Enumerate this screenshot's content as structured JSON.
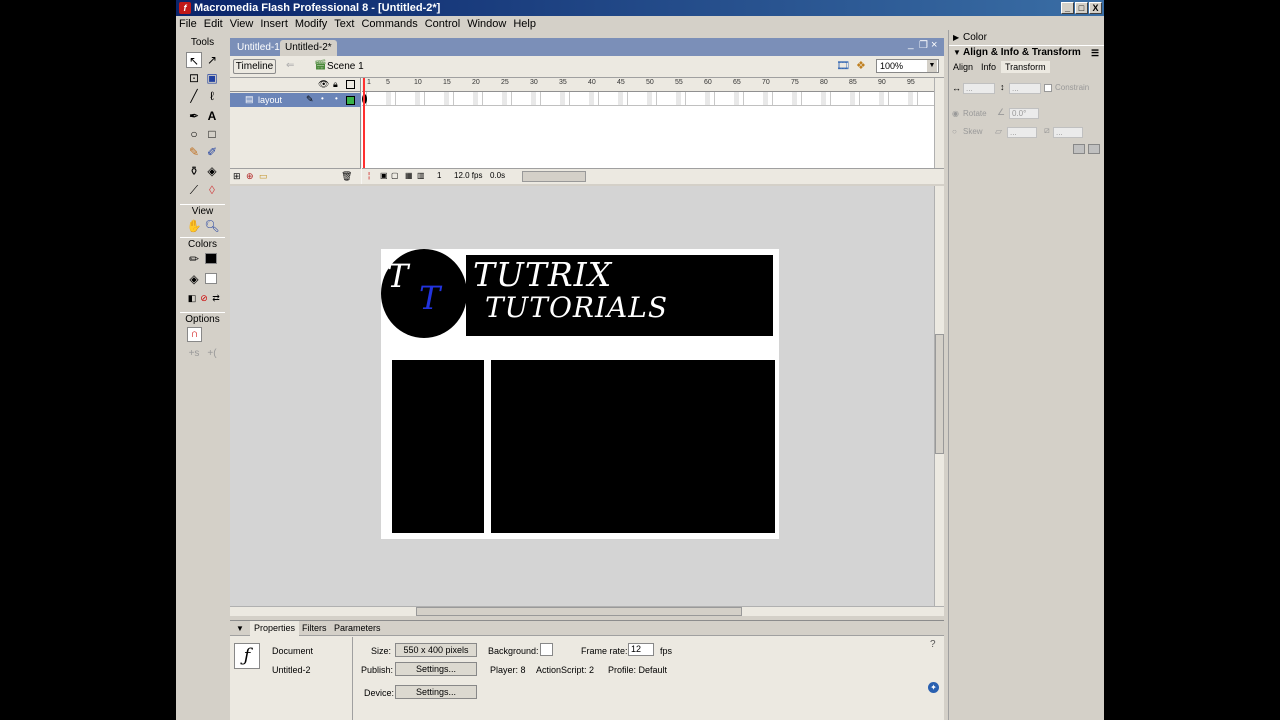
{
  "app": {
    "title": "Macromedia Flash Professional 8 - [Untitled-2*]",
    "icon": "flash-app-icon",
    "window_buttons": [
      "_",
      "□",
      "X"
    ]
  },
  "menu": [
    "File",
    "Edit",
    "View",
    "Insert",
    "Modify",
    "Text",
    "Commands",
    "Control",
    "Window",
    "Help"
  ],
  "tools": {
    "title": "Tools",
    "view_label": "View",
    "colors_label": "Colors",
    "options_label": "Options"
  },
  "document": {
    "tabs": [
      "Untitled-1*",
      "Untitled-2*"
    ],
    "active_tab": 1,
    "timeline_button": "Timeline",
    "scene": "Scene 1",
    "zoom": "100%",
    "doc_controls": [
      "_",
      "❐",
      "×"
    ]
  },
  "timeline": {
    "layer_name": "layout",
    "ruler_ticks": [
      "1",
      "5",
      "10",
      "15",
      "20",
      "25",
      "30",
      "35",
      "40",
      "45",
      "50",
      "55",
      "60",
      "65",
      "70",
      "75",
      "80",
      "85",
      "90",
      "95"
    ],
    "current_frame": "1",
    "fps": "12.0 fps",
    "time": "0.0s"
  },
  "stage": {
    "logo_letters": [
      "T",
      "T"
    ],
    "banner_line1": "TUTRIX",
    "banner_line2": "TUTORIALS",
    "colors": {
      "blue": "#2233dd",
      "black": "#000000",
      "white": "#ffffff"
    }
  },
  "properties": {
    "tabs": [
      "Properties",
      "Filters",
      "Parameters"
    ],
    "doc_type": "Document",
    "doc_name": "Untitled-2",
    "size_label": "Size:",
    "size_value": "550 x 400 pixels",
    "background_label": "Background:",
    "framerate_label": "Frame rate:",
    "framerate_value": "12",
    "fps_label": "fps",
    "publish_label": "Publish:",
    "settings_label": "Settings...",
    "player_label": "Player: 8",
    "actionscript_label": "ActionScript: 2",
    "profile_label": "Profile: Default",
    "device_label": "Device:",
    "device_settings_label": "Settings..."
  },
  "right_panel": {
    "color_title": "Color",
    "align_title": "Align & Info & Transform",
    "tabs": [
      "Align",
      "Info",
      "Transform"
    ],
    "constrain": "Constrain",
    "rotate": "Rotate",
    "skew": "Skew",
    "rotate_value": "0.0°"
  }
}
